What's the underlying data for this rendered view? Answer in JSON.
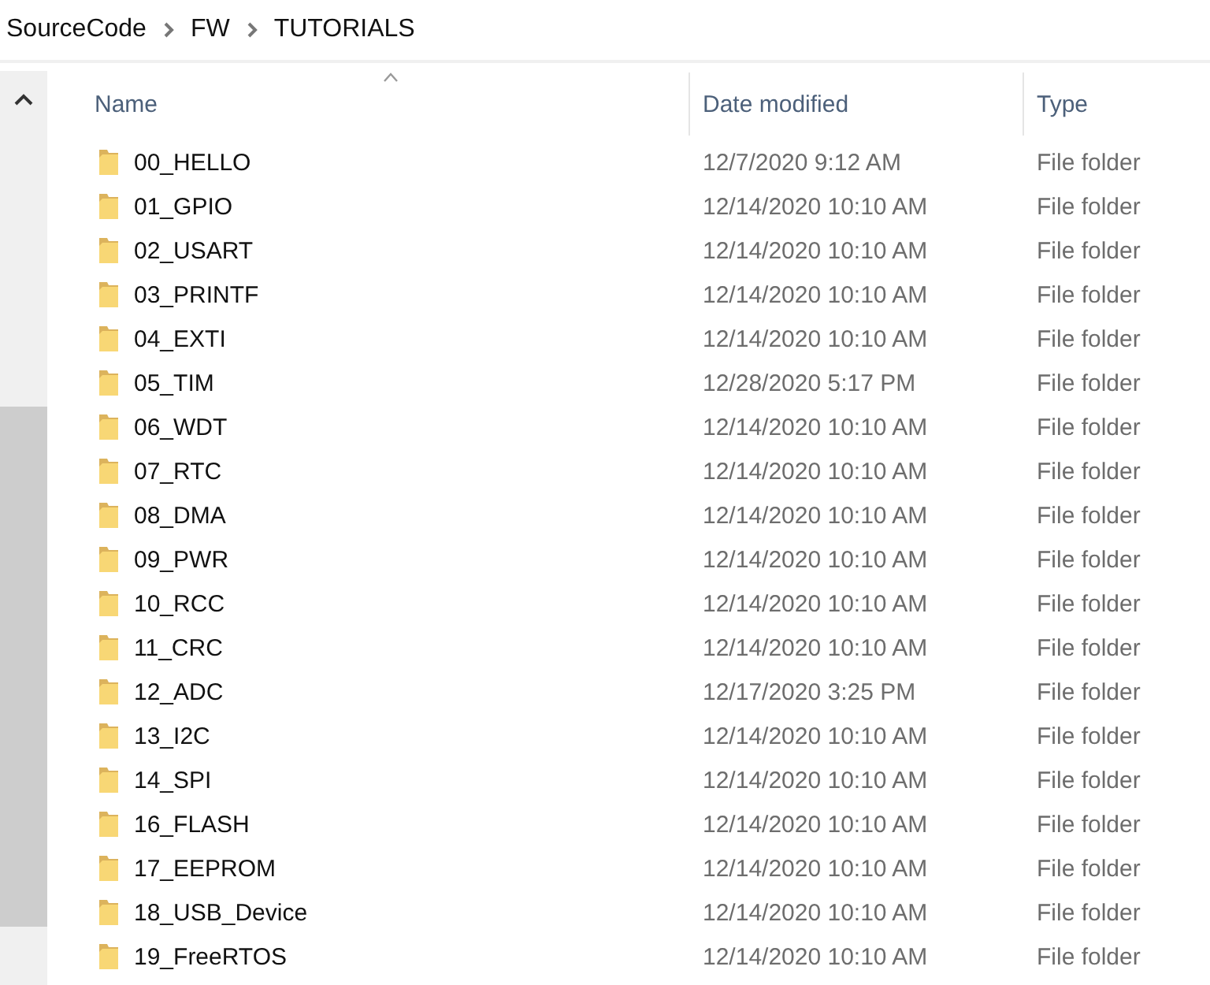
{
  "breadcrumb": [
    "SourceCode",
    "FW",
    "TUTORIALS"
  ],
  "columns": [
    {
      "label": "Name",
      "sorted": true
    },
    {
      "label": "Date modified",
      "sorted": false
    },
    {
      "label": "Type",
      "sorted": false
    }
  ],
  "rows": [
    {
      "name": "00_HELLO",
      "date": "12/7/2020 9:12 AM",
      "type": "File folder"
    },
    {
      "name": "01_GPIO",
      "date": "12/14/2020 10:10 AM",
      "type": "File folder"
    },
    {
      "name": "02_USART",
      "date": "12/14/2020 10:10 AM",
      "type": "File folder"
    },
    {
      "name": "03_PRINTF",
      "date": "12/14/2020 10:10 AM",
      "type": "File folder"
    },
    {
      "name": "04_EXTI",
      "date": "12/14/2020 10:10 AM",
      "type": "File folder"
    },
    {
      "name": "05_TIM",
      "date": "12/28/2020 5:17 PM",
      "type": "File folder"
    },
    {
      "name": "06_WDT",
      "date": "12/14/2020 10:10 AM",
      "type": "File folder"
    },
    {
      "name": "07_RTC",
      "date": "12/14/2020 10:10 AM",
      "type": "File folder"
    },
    {
      "name": "08_DMA",
      "date": "12/14/2020 10:10 AM",
      "type": "File folder"
    },
    {
      "name": "09_PWR",
      "date": "12/14/2020 10:10 AM",
      "type": "File folder"
    },
    {
      "name": "10_RCC",
      "date": "12/14/2020 10:10 AM",
      "type": "File folder"
    },
    {
      "name": "11_CRC",
      "date": "12/14/2020 10:10 AM",
      "type": "File folder"
    },
    {
      "name": "12_ADC",
      "date": "12/17/2020 3:25 PM",
      "type": "File folder"
    },
    {
      "name": "13_I2C",
      "date": "12/14/2020 10:10 AM",
      "type": "File folder"
    },
    {
      "name": "14_SPI",
      "date": "12/14/2020 10:10 AM",
      "type": "File folder"
    },
    {
      "name": "16_FLASH",
      "date": "12/14/2020 10:10 AM",
      "type": "File folder"
    },
    {
      "name": "17_EEPROM",
      "date": "12/14/2020 10:10 AM",
      "type": "File folder"
    },
    {
      "name": "18_USB_Device",
      "date": "12/14/2020 10:10 AM",
      "type": "File folder"
    },
    {
      "name": "19_FreeRTOS",
      "date": "12/14/2020 10:10 AM",
      "type": "File folder"
    }
  ]
}
